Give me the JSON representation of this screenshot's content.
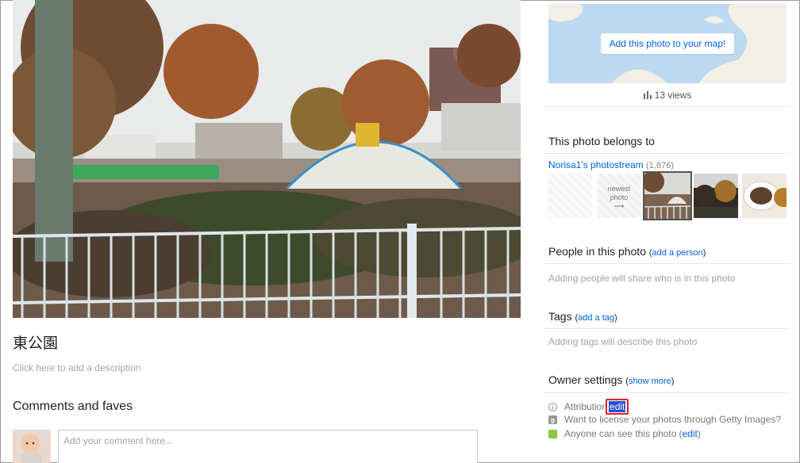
{
  "photo": {
    "title": "東公園",
    "description_placeholder": "Click here to add a description"
  },
  "comments": {
    "heading": "Comments and faves",
    "input_placeholder": "Add your comment here..."
  },
  "map": {
    "button_label": "Add this photo to your map!"
  },
  "stats": {
    "views": "13 views"
  },
  "belongs": {
    "heading": "This photo belongs to",
    "stream_link": "Norisa1's photostream",
    "stream_count": "(1,876)",
    "newest_label": "newest photo",
    "newest_arrow": "⟶"
  },
  "people": {
    "heading": "People in this photo",
    "open": "(",
    "action": "add a person",
    "close": ")",
    "hint": "Adding people will share who is in this photo"
  },
  "tags": {
    "heading": "Tags",
    "open": "(",
    "action": "add a tag",
    "close": ")",
    "hint": "Adding tags will describe this photo"
  },
  "owner": {
    "heading": "Owner settings",
    "open": "(",
    "action": "show more",
    "close": ")",
    "attribution_label": "Attribution",
    "attribution_edit": "edit",
    "getty_label": "Want to license your photos through Getty Images?",
    "privacy_label": "Anyone can see this photo",
    "privacy_edit": "edit",
    "privacy_open": "(",
    "privacy_close": ")"
  },
  "colors": {
    "link": "#0063dc",
    "highlight_border": "#e0201f",
    "privacy_badge": "#8cc63f"
  }
}
